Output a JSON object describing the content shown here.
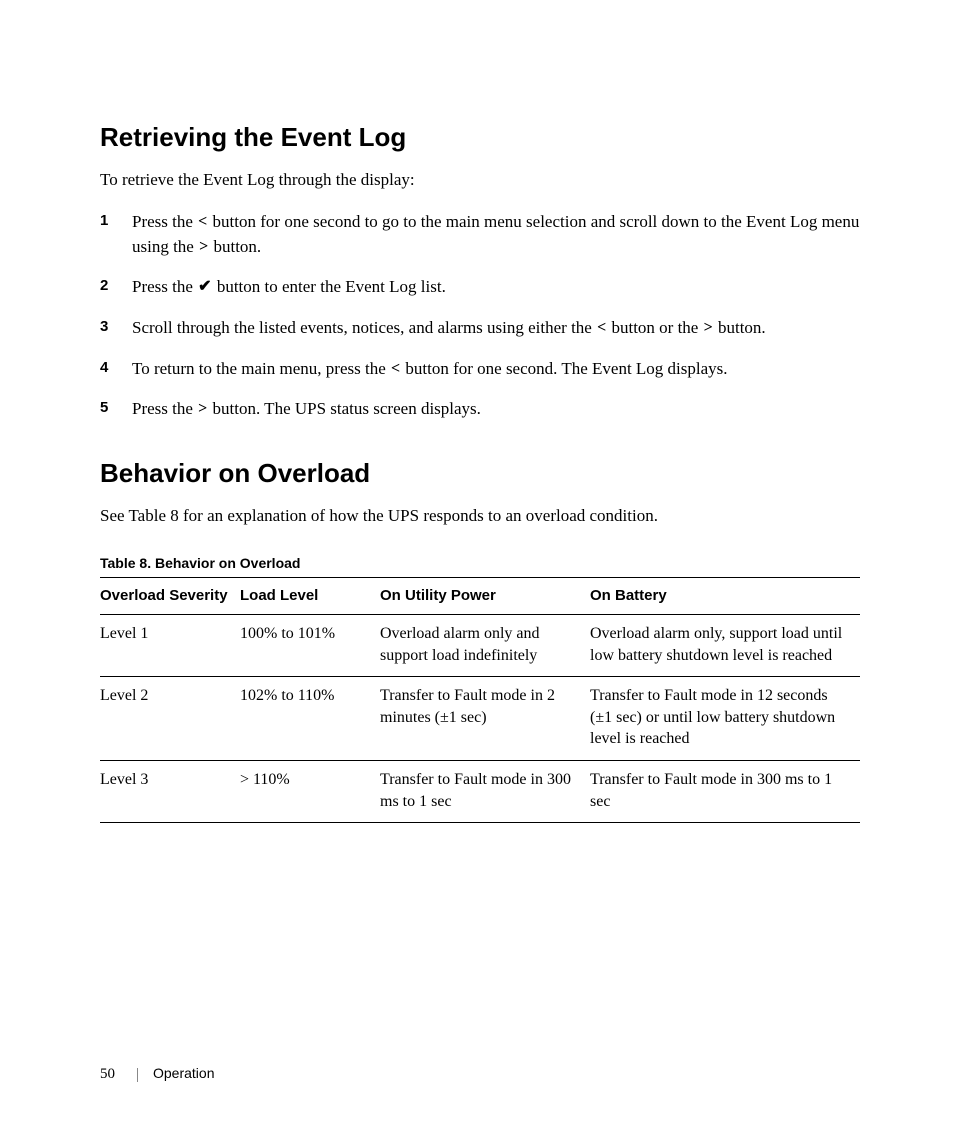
{
  "section1": {
    "title": "Retrieving the Event Log",
    "intro": "To retrieve the Event Log through the display:",
    "steps": [
      {
        "num": "1",
        "parts": [
          {
            "t": "text",
            "v": "Press the "
          },
          {
            "t": "icon",
            "name": "left-icon",
            "glyph": "<"
          },
          {
            "t": "text",
            "v": " button for one second to go to the main menu selection and scroll down to the Event Log menu using the "
          },
          {
            "t": "icon",
            "name": "right-icon",
            "glyph": ">"
          },
          {
            "t": "text",
            "v": " button."
          }
        ]
      },
      {
        "num": "2",
        "parts": [
          {
            "t": "text",
            "v": "Press the "
          },
          {
            "t": "icon",
            "name": "check-icon",
            "glyph": "✔"
          },
          {
            "t": "text",
            "v": " button to enter the Event Log list."
          }
        ]
      },
      {
        "num": "3",
        "parts": [
          {
            "t": "text",
            "v": "Scroll through the listed events, notices, and alarms using either the "
          },
          {
            "t": "icon",
            "name": "left-icon",
            "glyph": "<"
          },
          {
            "t": "text",
            "v": " button or the "
          },
          {
            "t": "icon",
            "name": "right-icon",
            "glyph": ">"
          },
          {
            "t": "text",
            "v": " button."
          }
        ]
      },
      {
        "num": "4",
        "parts": [
          {
            "t": "text",
            "v": "To return to the main menu, press the "
          },
          {
            "t": "icon",
            "name": "left-icon",
            "glyph": "<"
          },
          {
            "t": "text",
            "v": " button for one second. The Event Log displays."
          }
        ]
      },
      {
        "num": "5",
        "parts": [
          {
            "t": "text",
            "v": "Press the "
          },
          {
            "t": "icon",
            "name": "right-icon",
            "glyph": ">"
          },
          {
            "t": "text",
            "v": " button. The UPS status screen displays."
          }
        ]
      }
    ]
  },
  "section2": {
    "title": "Behavior on Overload",
    "intro": "See Table 8 for an explanation of how the UPS responds to an overload condition.",
    "table": {
      "caption": "Table 8. Behavior on Overload",
      "headers": [
        "Overload Severity",
        "Load Level",
        "On Utility Power",
        "On Battery"
      ],
      "rows": [
        {
          "severity": "Level 1",
          "load": "100% to 101%",
          "utility": "Overload alarm only and support load indefinitely",
          "battery": "Overload alarm only, support load until low battery shutdown level is reached"
        },
        {
          "severity": "Level 2",
          "load": "102% to 110%",
          "utility": "Transfer to Fault mode in 2 minutes (±1 sec)",
          "battery": "Transfer to Fault mode in 12 seconds (±1 sec) or until low battery shutdown level is reached"
        },
        {
          "severity": "Level 3",
          "load": "> 110%",
          "utility": "Transfer to Fault mode in 300 ms to 1 sec",
          "battery": "Transfer to Fault mode in 300 ms to 1 sec"
        }
      ]
    }
  },
  "footer": {
    "pageNumber": "50",
    "sectionName": "Operation"
  }
}
